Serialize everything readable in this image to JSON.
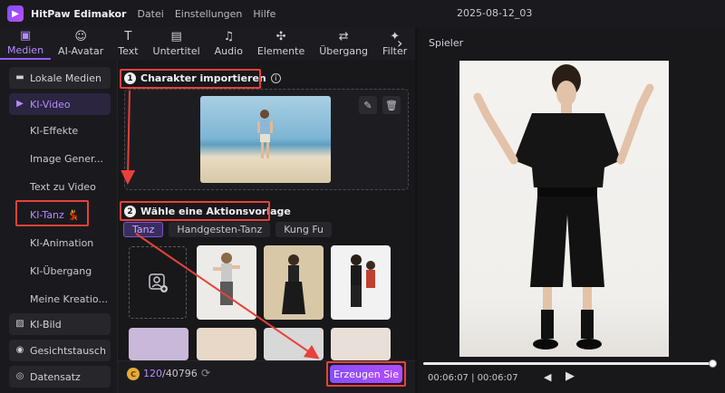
{
  "app": {
    "name": "HitPaw Edimakor",
    "menu": [
      "Datei",
      "Einstellungen",
      "Hilfe"
    ],
    "project_title": "2025-08-12_03"
  },
  "toolbar": {
    "items": [
      {
        "label": "Medien",
        "icon": "media-icon",
        "glyph": "▣"
      },
      {
        "label": "AI-Avatar",
        "icon": "avatar-icon",
        "glyph": "☺"
      },
      {
        "label": "Text",
        "icon": "text-icon",
        "glyph": "T"
      },
      {
        "label": "Untertitel",
        "icon": "subtitle-icon",
        "glyph": "▤"
      },
      {
        "label": "Audio",
        "icon": "audio-icon",
        "glyph": "♫"
      },
      {
        "label": "Elemente",
        "icon": "elements-icon",
        "glyph": "✣"
      },
      {
        "label": "Übergang",
        "icon": "transition-icon",
        "glyph": "⇄"
      },
      {
        "label": "Filter",
        "icon": "filter-icon",
        "glyph": "✦"
      }
    ],
    "active": "Medien",
    "more_glyph": "›"
  },
  "sidebar": {
    "top": [
      {
        "label": "Lokale Medien",
        "icon": "folder-icon",
        "glyph": "▬"
      },
      {
        "label": "KI-Video",
        "icon": "video-icon",
        "glyph": "▶"
      }
    ],
    "sub": [
      {
        "label": "KI-Effekte"
      },
      {
        "label": "Image Gener..."
      },
      {
        "label": "Text zu Video"
      },
      {
        "label": "KI-Tanz 💃"
      },
      {
        "label": "KI-Animation"
      },
      {
        "label": "KI-Übergang"
      },
      {
        "label": "Meine Kreatio..."
      }
    ],
    "bottom": [
      {
        "label": "KI-Bild",
        "icon": "image-icon",
        "glyph": "▨"
      },
      {
        "label": "Gesichtstausch",
        "icon": "face-swap-icon",
        "glyph": "◉"
      },
      {
        "label": "Datensatz",
        "icon": "dataset-icon",
        "glyph": "◎"
      }
    ]
  },
  "step1": {
    "num": "1",
    "title": "Charakter importieren",
    "info": "i"
  },
  "step2": {
    "num": "2",
    "title": "Wähle eine Aktionsvorlage"
  },
  "tags": [
    "Tanz",
    "Handgesten-Tanz",
    "Kung Fu"
  ],
  "credits": {
    "used": "120",
    "total": "/40796",
    "coin": "C"
  },
  "generate_button": "Erzeugen Sie",
  "player": {
    "title": "Spieler",
    "time_current": "00:06:07",
    "time_sep": " | ",
    "time_total": "00:06:07",
    "progress": 1.0
  },
  "icons": {
    "edit": "✎",
    "delete": "🗑",
    "refresh": "⟳",
    "prev": "◀",
    "play": "▶"
  }
}
